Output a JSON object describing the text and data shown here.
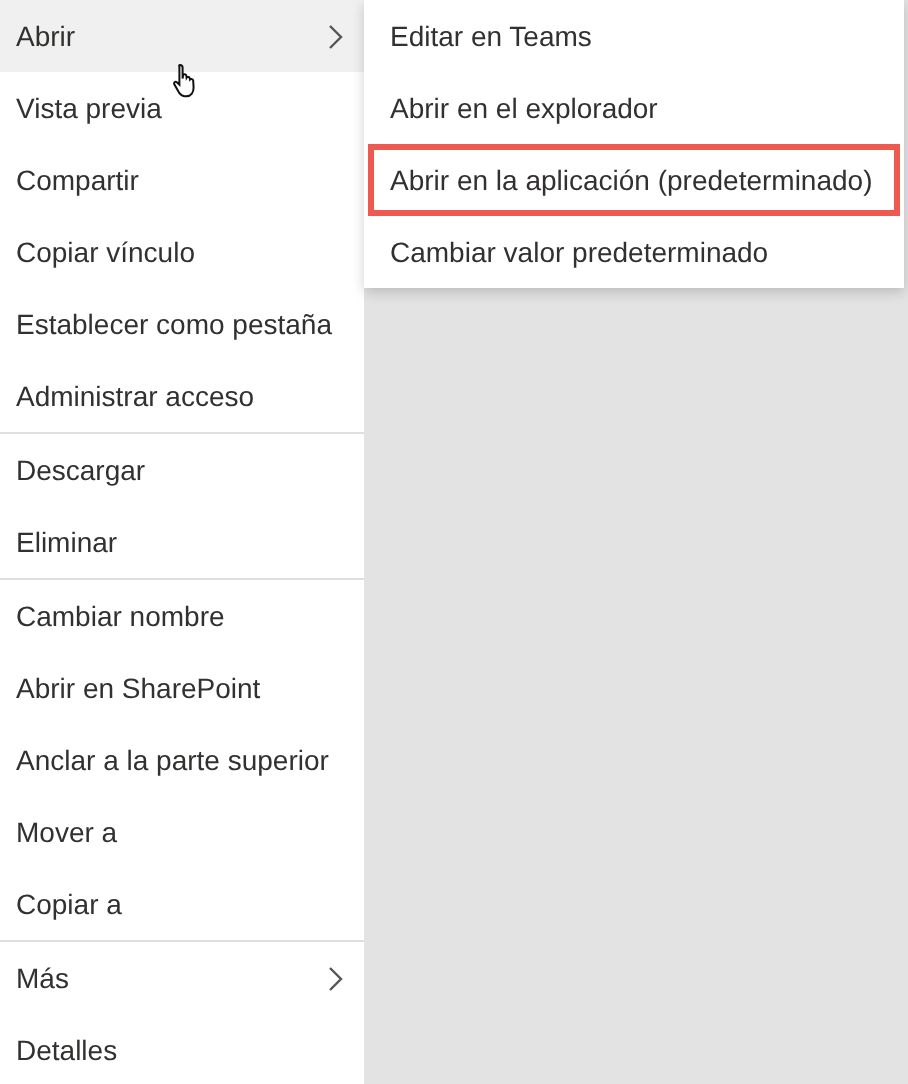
{
  "menu": {
    "groups": [
      {
        "items": [
          {
            "label": "Abrir",
            "kind": "submenu",
            "selected": true
          },
          {
            "label": "Vista previa",
            "kind": "item",
            "selected": false
          },
          {
            "label": "Compartir",
            "kind": "item",
            "selected": false
          },
          {
            "label": "Copiar vínculo",
            "kind": "item",
            "selected": false
          },
          {
            "label": "Establecer como pestaña",
            "kind": "item",
            "selected": false
          },
          {
            "label": "Administrar acceso",
            "kind": "item",
            "selected": false
          }
        ]
      },
      {
        "items": [
          {
            "label": "Descargar",
            "kind": "item",
            "selected": false
          },
          {
            "label": "Eliminar",
            "kind": "item",
            "selected": false
          }
        ]
      },
      {
        "items": [
          {
            "label": "Cambiar nombre",
            "kind": "item",
            "selected": false
          },
          {
            "label": "Abrir en SharePoint",
            "kind": "item",
            "selected": false
          },
          {
            "label": "Anclar a la parte superior",
            "kind": "item",
            "selected": false
          },
          {
            "label": "Mover a",
            "kind": "item",
            "selected": false
          },
          {
            "label": "Copiar a",
            "kind": "item",
            "selected": false
          }
        ]
      },
      {
        "items": [
          {
            "label": "Más",
            "kind": "submenu",
            "selected": false
          },
          {
            "label": "Detalles",
            "kind": "item",
            "selected": false
          }
        ]
      }
    ]
  },
  "submenu": {
    "items": [
      {
        "label": "Editar en Teams",
        "highlighted": false
      },
      {
        "label": "Abrir en el explorador",
        "highlighted": false
      },
      {
        "label": "Abrir en la aplicación (predeterminado)",
        "highlighted": true
      },
      {
        "label": "Cambiar valor predeterminado",
        "highlighted": false
      }
    ]
  }
}
